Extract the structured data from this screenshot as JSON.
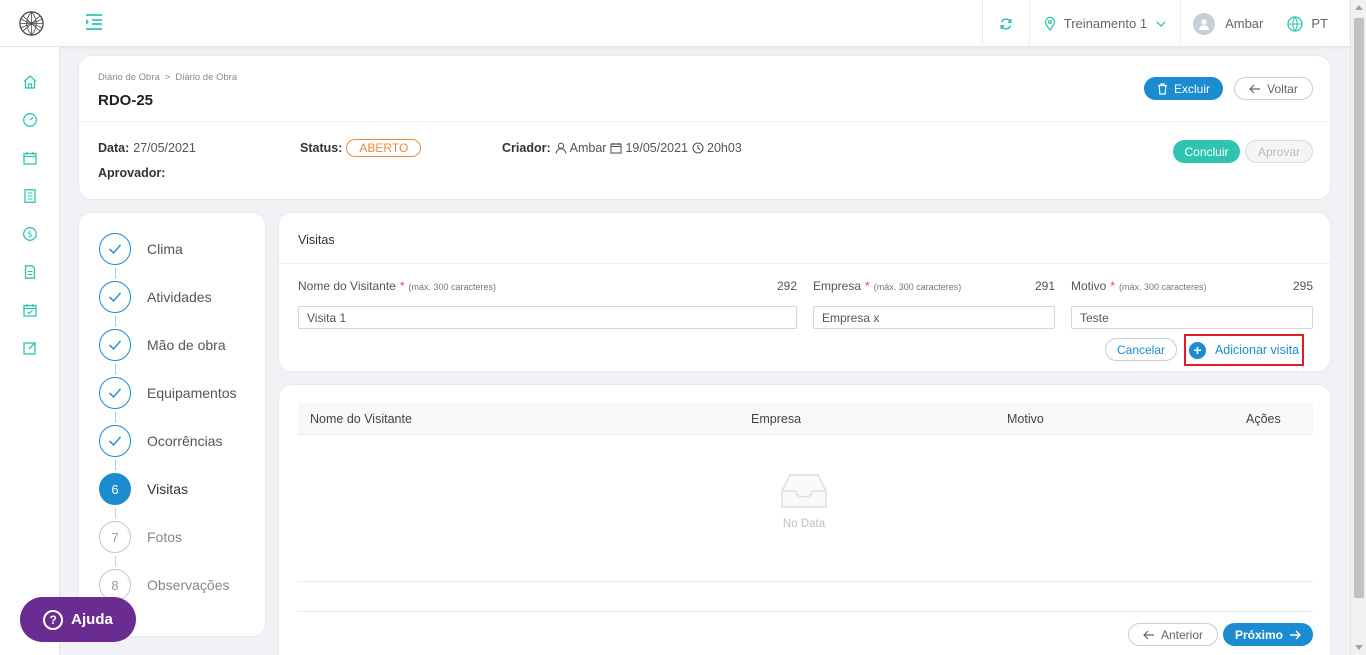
{
  "topbar": {
    "project": "Treinamento 1",
    "user": "Ambar",
    "language": "PT"
  },
  "breadcrumb": [
    "Diário de Obra",
    "Diário de Obra"
  ],
  "breadcrumb_sep": ">",
  "page_title": "RDO-25",
  "actions": {
    "delete": "Excluir",
    "back": "Voltar",
    "complete": "Concluir",
    "approve": "Aprovar"
  },
  "meta": {
    "date_label": "Data:",
    "date_value": "27/05/2021",
    "status_label": "Status:",
    "status_value": "ABERTO",
    "creator_label": "Criador:",
    "creator_name": "Ambar",
    "created_date": "19/05/2021",
    "created_time": "20h03",
    "approver_label": "Aprovador:"
  },
  "steps": [
    {
      "label": "Clima",
      "marker": "",
      "state": "done"
    },
    {
      "label": "Atividades",
      "marker": "",
      "state": "done"
    },
    {
      "label": "Mão de obra",
      "marker": "",
      "state": "done"
    },
    {
      "label": "Equipamentos",
      "marker": "",
      "state": "done"
    },
    {
      "label": "Ocorrências",
      "marker": "",
      "state": "done"
    },
    {
      "label": "Visitas",
      "marker": "6",
      "state": "active"
    },
    {
      "label": "Fotos",
      "marker": "7",
      "state": "pending"
    },
    {
      "label": "Observações",
      "marker": "8",
      "state": "pending"
    }
  ],
  "form": {
    "title": "Visitas",
    "fields": [
      {
        "label": "Nome do Visitante",
        "required": "*",
        "hint": "(máx. 300 caracteres)",
        "remaining": "292",
        "value": "Visita 1"
      },
      {
        "label": "Empresa",
        "required": "*",
        "hint": "(máx. 300 caracteres)",
        "remaining": "291",
        "value": "Empresa x"
      },
      {
        "label": "Motivo",
        "required": "*",
        "hint": "(máx. 300 caracteres)",
        "remaining": "295",
        "value": "Teste"
      }
    ],
    "cancel": "Cancelar",
    "add": "Adicionar visita",
    "add_symbol": "+"
  },
  "table": {
    "columns": [
      "Nome do Visitante",
      "Empresa",
      "Motivo",
      "Ações"
    ],
    "empty": "No Data"
  },
  "pagination": {
    "previous": "Anterior",
    "next": "Próximo"
  },
  "help": {
    "label": "Ajuda",
    "symbol": "?"
  },
  "colors": {
    "primary": "#1a8ccf",
    "teal": "#2ec4b0",
    "status": "#f08a3c",
    "help": "#6a2c91",
    "highlight": "#e21b2b"
  }
}
